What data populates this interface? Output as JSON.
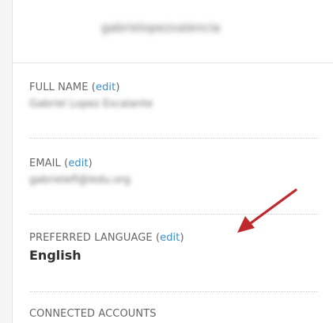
{
  "header": {
    "username": "gabrielopezvalencia"
  },
  "profile": {
    "full_name": {
      "label": "FULL NAME ",
      "edit_open": "(",
      "edit_label": "edit",
      "edit_close": ")",
      "value": "Gabriel Lopez Escalante"
    },
    "email": {
      "label": "EMAIL ",
      "edit_open": "(",
      "edit_label": "edit",
      "edit_close": ")",
      "value": "gabrielefl@ledu.org"
    },
    "language": {
      "label": "PREFERRED LANGUAGE ",
      "edit_open": "(",
      "edit_label": "edit",
      "edit_close": ")",
      "value": "English"
    },
    "connected_accounts": {
      "label": "CONNECTED ACCOUNTS"
    }
  },
  "annotation": {
    "arrow_color": "#c0282b",
    "arrow_icon": "red-arrow-icon"
  },
  "colors": {
    "link": "#3a8ec7",
    "label": "#666666",
    "value": "#2e2e2e"
  }
}
